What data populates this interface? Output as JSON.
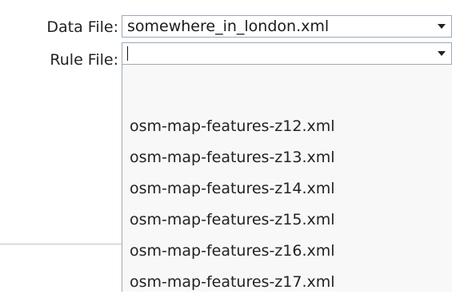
{
  "data_file": {
    "label": "Data File:",
    "value": "somewhere_in_london.xml"
  },
  "rule_file": {
    "label": "Rule File:",
    "value": ""
  },
  "dropdown": {
    "options": [
      "",
      "osm-map-features-z12.xml",
      "osm-map-features-z13.xml",
      "osm-map-features-z14.xml",
      "osm-map-features-z15.xml",
      "osm-map-features-z16.xml",
      "osm-map-features-z17.xml"
    ]
  },
  "icons": {
    "combo_arrow": "chevron-down-icon"
  },
  "colors": {
    "field_border": "#9ca9b6",
    "popup_background": "#f8f8f8",
    "text": "#222222"
  }
}
